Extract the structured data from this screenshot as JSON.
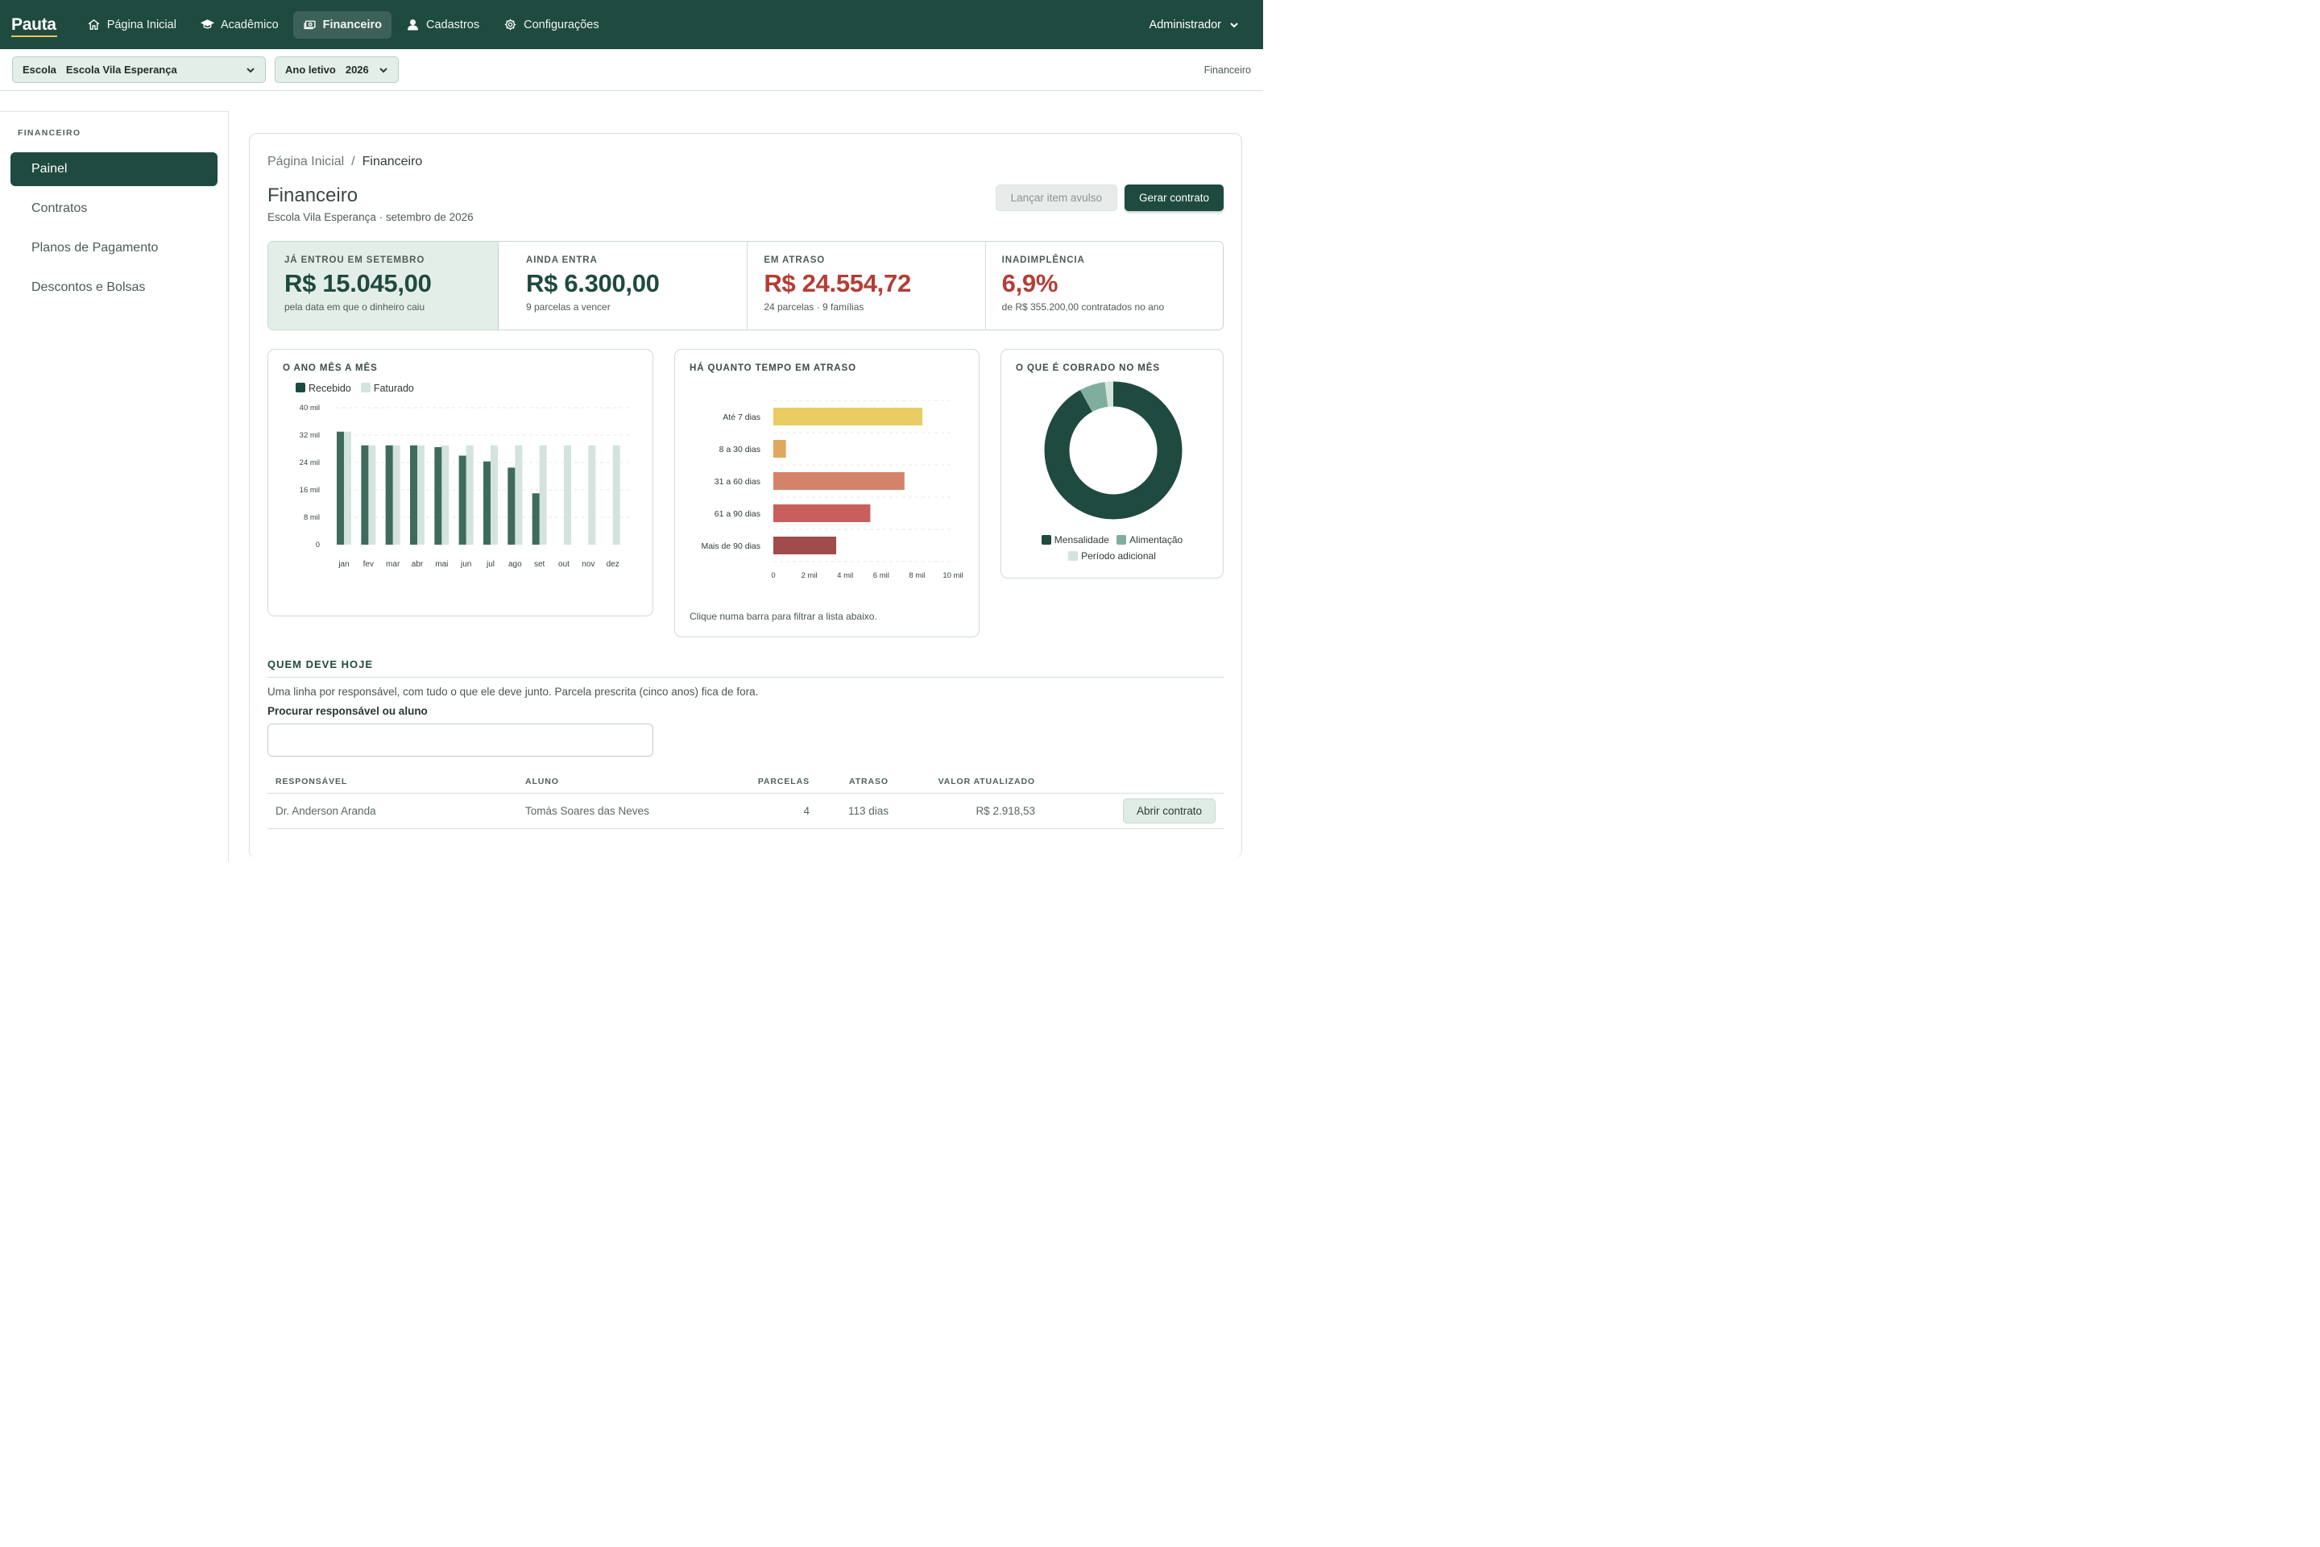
{
  "app": {
    "logo": "Pauta"
  },
  "nav": {
    "items": [
      {
        "label": "Página Inicial"
      },
      {
        "label": "Acadêmico"
      },
      {
        "label": "Financeiro"
      },
      {
        "label": "Cadastros"
      },
      {
        "label": "Configurações"
      }
    ],
    "active": "Financeiro",
    "user": "Administrador"
  },
  "filters": {
    "school_label": "Escola",
    "school_value": "Escola Vila Esperança",
    "year_label": "Ano letivo",
    "year_value": "2026",
    "context": "Financeiro"
  },
  "sidebar": {
    "title": "FINANCEIRO",
    "items": [
      {
        "label": "Painel"
      },
      {
        "label": "Contratos"
      },
      {
        "label": "Planos de Pagamento"
      },
      {
        "label": "Descontos e Bolsas"
      }
    ],
    "active": "Painel"
  },
  "page": {
    "breadcrumb": [
      "Página Inicial",
      "Financeiro"
    ],
    "breadcrumb_sep": "/",
    "title": "Financeiro",
    "subtitle": "Escola Vila Esperança · setembro de 2026",
    "secondary_button": "Lançar item avulso",
    "primary_button": "Gerar contrato"
  },
  "kpis": [
    {
      "label": "JÁ ENTROU EM SETEMBRO",
      "value": "R$ 15.045,00",
      "note": "pela data em que o dinheiro caiu",
      "tone": "green"
    },
    {
      "label": "AINDA ENTRA",
      "value": "R$ 6.300,00",
      "note": "9 parcelas a vencer",
      "tone": "green"
    },
    {
      "label": "EM ATRASO",
      "value": "R$ 24.554,72",
      "note": "24 parcelas · 9 famílias",
      "tone": "red"
    },
    {
      "label": "INADIMPLÊNCIA",
      "value": "6,9%",
      "note": "de R$ 355.200,00 contratados no ano",
      "tone": "red"
    }
  ],
  "colors": {
    "brand": "#1f4a3f",
    "recebido": "#3f6b5d",
    "faturado": "#d3e4dd",
    "danger": "#b43d34",
    "aging": [
      "#e9cc62",
      "#e0a85f",
      "#d4836a",
      "#c95f5c",
      "#a04c4c"
    ],
    "donut": [
      "#1f4a3f",
      "#7fae9e",
      "#d3e4dd"
    ]
  },
  "chart_data": [
    {
      "type": "bar",
      "title": "O ANO MÊS A MÊS",
      "categories": [
        "jan",
        "fev",
        "mar",
        "abr",
        "mai",
        "jun",
        "jul",
        "ago",
        "set",
        "out",
        "nov",
        "dez"
      ],
      "series": [
        {
          "name": "Recebido",
          "values": [
            33000,
            29000,
            29000,
            29000,
            28500,
            26000,
            24300,
            22500,
            15000,
            0,
            0,
            0
          ]
        },
        {
          "name": "Faturado",
          "values": [
            33000,
            29000,
            29000,
            29000,
            29000,
            29000,
            29000,
            29000,
            29000,
            29000,
            29000,
            29000
          ]
        }
      ],
      "yticks": [
        "0",
        "8 mil",
        "16 mil",
        "24 mil",
        "32 mil",
        "40 mil"
      ],
      "ylim": [
        0,
        40000
      ],
      "grid": true,
      "legend": "top-left"
    },
    {
      "type": "bar",
      "orientation": "horizontal",
      "title": "HÁ QUANTO TEMPO EM ATRASO",
      "categories": [
        "Até 7 dias",
        "8 a 30 dias",
        "31 a 60 dias",
        "61 a 90 dias",
        "Mais de 90 dias"
      ],
      "values": [
        8300,
        700,
        7300,
        5400,
        3500
      ],
      "xticks": [
        "0",
        "2 mil",
        "4 mil",
        "6 mil",
        "8 mil",
        "10 mil"
      ],
      "xlim": [
        0,
        10000
      ],
      "grid": true,
      "hint": "Clique numa barra para filtrar a lista abaixo."
    },
    {
      "type": "pie",
      "title": "O QUE É COBRADO NO MÊS",
      "categories": [
        "Mensalidade",
        "Alimentação",
        "Período adicional"
      ],
      "values": [
        92,
        6,
        2
      ],
      "legend": "bottom"
    }
  ],
  "debtors": {
    "title": "QUEM DEVE HOJE",
    "description": "Uma linha por responsável, com tudo o que ele deve junto. Parcela prescrita (cinco anos) fica de fora.",
    "search_label": "Procurar responsável ou aluno",
    "search_value": "",
    "columns": [
      "RESPONSÁVEL",
      "ALUNO",
      "PARCELAS",
      "ATRASO",
      "VALOR ATUALIZADO"
    ],
    "rows": [
      {
        "responsavel": "Dr. Anderson Aranda",
        "aluno": "Tomás Soares das Neves",
        "parcelas": "4",
        "atraso": "113 dias",
        "valor": "R$ 2.918,53",
        "action": "Abrir contrato"
      }
    ]
  }
}
